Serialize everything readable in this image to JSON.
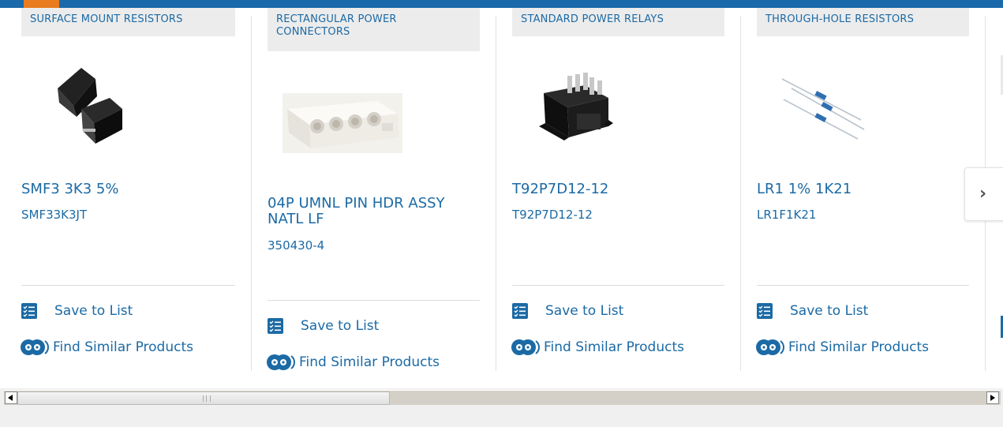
{
  "products": [
    {
      "category": "SURFACE MOUNT RESISTORS",
      "name": "SMF3 3K3 5%",
      "part_number": "SMF33K3JT",
      "save_label": "Save to List",
      "similar_label": "Find Similar Products"
    },
    {
      "category": "RECTANGULAR POWER CONNECTORS",
      "name": "04P UMNL PIN HDR ASSY NATL LF",
      "part_number": "350430-4",
      "save_label": "Save to List",
      "similar_label": "Find Similar Products"
    },
    {
      "category": "STANDARD POWER RELAYS",
      "name": "T92P7D12-12",
      "part_number": "T92P7D12-12",
      "save_label": "Save to List",
      "similar_label": "Find Similar Products"
    },
    {
      "category": "THROUGH-HOLE RESISTORS",
      "name": "LR1 1% 1K21",
      "part_number": "LR1F1K21",
      "save_label": "Save to List",
      "similar_label": "Find Similar Products"
    }
  ],
  "carousel": {
    "next_glyph": "›"
  },
  "scrollbar": {
    "position_fraction": 0.0
  },
  "colors": {
    "brand_blue": "#1a6aab",
    "accent_orange": "#e87c1e",
    "link_blue": "#1b6aa5"
  }
}
